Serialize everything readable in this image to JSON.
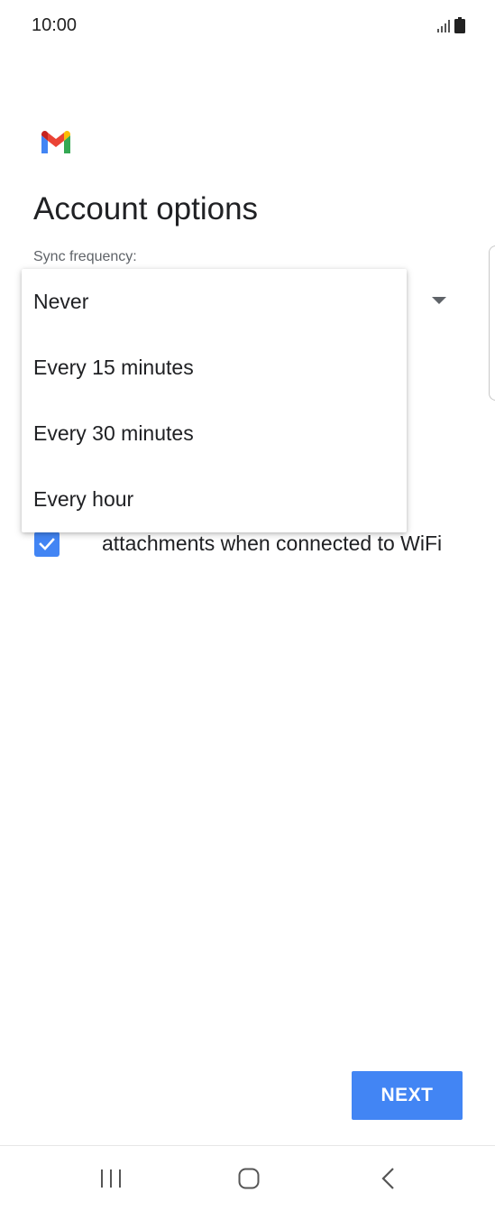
{
  "status_bar": {
    "time": "10:00"
  },
  "page": {
    "title": "Account options",
    "sync_label": "Sync frequency:"
  },
  "sync_dropdown": {
    "options": [
      "Never",
      "Every 15 minutes",
      "Every 30 minutes",
      "Every hour"
    ]
  },
  "attachments_checkbox": {
    "checked": true,
    "label": "attachments when connected to WiFi"
  },
  "buttons": {
    "next": "NEXT"
  },
  "colors": {
    "accent": "#4285f4"
  }
}
